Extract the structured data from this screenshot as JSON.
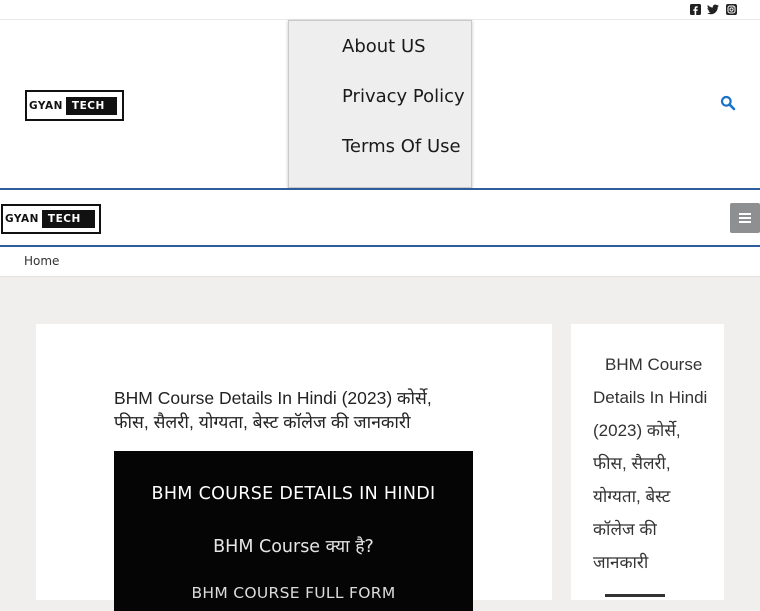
{
  "social": {
    "icons": [
      "facebook-icon",
      "twitter-icon",
      "instagram-icon"
    ]
  },
  "header": {
    "logo": {
      "part1": "GYAN",
      "part2": "TECH"
    },
    "menu": {
      "items": [
        {
          "label": "About US"
        },
        {
          "label": "Privacy Policy"
        },
        {
          "label": "Terms Of Use"
        }
      ]
    },
    "search_icon": "search-icon"
  },
  "mobile_header": {
    "logo": {
      "part1": "GYAN",
      "part2": "TECH"
    },
    "toggle_icon": "hamburger-icon"
  },
  "breadcrumb": {
    "home": "Home"
  },
  "article": {
    "title": "BHM Course Details In Hindi (2023) कोर्से, फीस, सैलरी, योग्यता, बेस्ट कॉलेज की जानकारी",
    "featured_image": {
      "line1": "BHM COURSE DETAILS IN HINDI",
      "line2": "BHM Course क्या है?",
      "line3": "BHM COURSE FULL FORM"
    }
  },
  "sidebar": {
    "recent_post_part1": "BHM Course Details In Hindi (2023)",
    "recent_post_part2": "कोर्से, फीस, सैलरी, योग्यता, बेस्ट कॉलेज की जानकारी"
  },
  "colors": {
    "accent_blue": "#2e5c9c",
    "search_blue": "#1a73c9",
    "page_bg": "#f1efee",
    "toggle_gray": "#8d8f90"
  }
}
